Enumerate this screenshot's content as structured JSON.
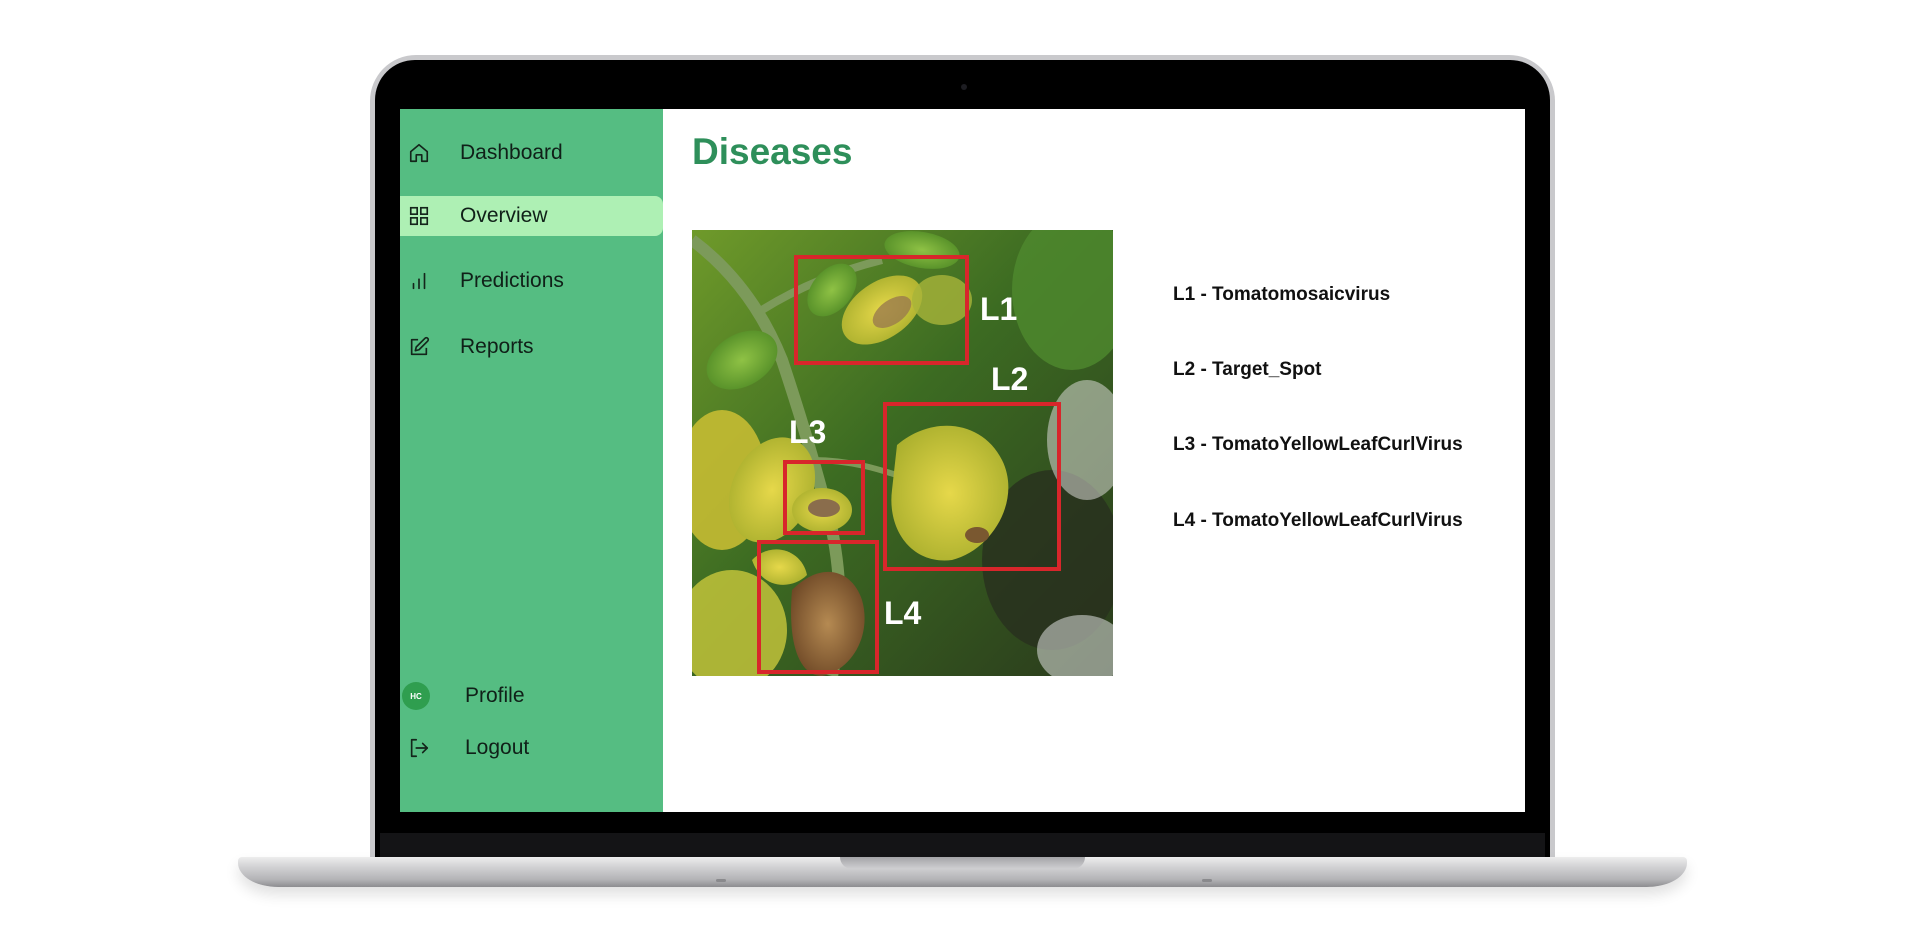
{
  "nav": {
    "items": [
      {
        "label": "Dashboard",
        "icon": "home-icon",
        "active": false
      },
      {
        "label": "Overview",
        "icon": "grid-icon",
        "active": true
      },
      {
        "label": "Predictions",
        "icon": "bar-chart-icon",
        "active": false
      },
      {
        "label": "Reports",
        "icon": "edit-icon",
        "active": false
      }
    ],
    "profile": {
      "label": "Profile",
      "avatar_initials": "HC"
    },
    "logout": {
      "label": "Logout",
      "icon": "logout-icon"
    }
  },
  "main": {
    "title": "Diseases",
    "image_labels": [
      "L1",
      "L2",
      "L3",
      "L4"
    ],
    "legend": [
      "L1 - Tomatomosaicvirus",
      "L2 - Target_Spot",
      "L3 - TomatoYellowLeafCurlVirus",
      "L4 - TomatoYellowLeafCurlVirus"
    ]
  },
  "colors": {
    "sidebar_bg": "#55bd82",
    "active_item_bg": "#aef0b4",
    "title_green": "#2e8f5a",
    "box_red": "#d8262b",
    "avatar_bg": "#2f9e4f"
  }
}
